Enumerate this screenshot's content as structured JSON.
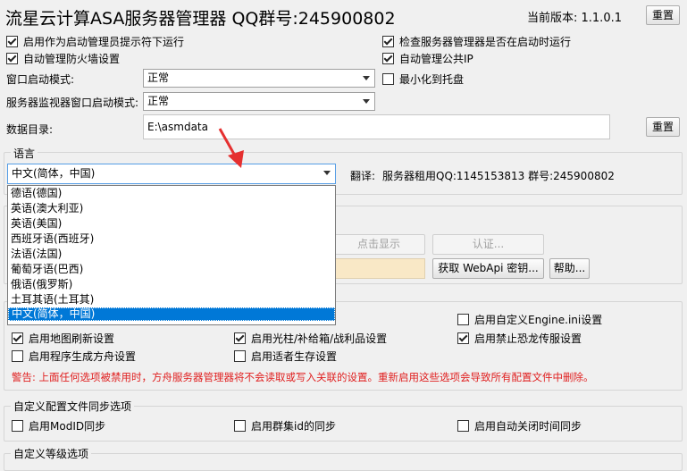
{
  "header": {
    "title": "流星云计算ASA服务器管理器 QQ群号:245900802",
    "version_label": "当前版本:  1.1.0.1",
    "reset_label": "重置"
  },
  "options": {
    "run_as_admin": {
      "label": "启用作为启动管理员提示符下运行",
      "checked": true
    },
    "check_startup": {
      "label": "检查服务器管理器是否在启动时运行",
      "checked": true
    },
    "auto_firewall": {
      "label": "自动管理防火墙设置",
      "checked": true
    },
    "auto_public_ip": {
      "label": "自动管理公共IP",
      "checked": true
    },
    "minimize_tray": {
      "label": "最小化到托盘",
      "checked": false
    }
  },
  "window_mode": {
    "label": "窗口启动模式:",
    "value": "正常"
  },
  "monitor_mode": {
    "label": "服务器监视器窗口启动模式:",
    "value": "正常"
  },
  "data_dir": {
    "label": "数据目录:",
    "value": "E:\\asmdata",
    "reset_label": "重置"
  },
  "language": {
    "group_title": "语言",
    "selected": "中文(简体，中国)",
    "translation_label": "翻译:",
    "translation_credit": "服务器租用QQ:1145153813 群号:245900802",
    "options": [
      "德语(德国)",
      "英语(澳大利亚)",
      "英语(美国)",
      "西班牙语(西班牙)",
      "法语(法国)",
      "葡萄牙语(巴西)",
      "俄语(俄罗斯)",
      "土耳其语(土耳其)",
      "中文(简体，中国)"
    ]
  },
  "webapi": {
    "show_label": "点击显示",
    "auth_label": "认证...",
    "get_key_label": "获取 WebApi 密钥...",
    "help_label": "帮助..."
  },
  "custom": {
    "engine_ini": {
      "label": "启用自定义Engine.ini设置",
      "checked": false
    },
    "map_refresh": {
      "label": "启用地图刷新设置",
      "checked": true
    },
    "beacon": {
      "label": "启用光柱/补给箱/战利品设置",
      "checked": true
    },
    "dino_spread": {
      "label": "启用禁止恐龙传服设置",
      "checked": true
    },
    "ark_gen": {
      "label": "启用程序生成方舟设置",
      "checked": false
    },
    "survivor": {
      "label": "启用适者生存设置",
      "checked": false
    },
    "warning": "警告: 上面任何选项被禁用时，方舟服务器管理器将不会读取或写入关联的设置。重新启用这些选项会导致所有配置文件中删除。"
  },
  "sync": {
    "group_title": "自定义配置文件同步选项",
    "mod_id": {
      "label": "启用ModID同步",
      "checked": false
    },
    "cluster_id": {
      "label": "启用群集id的同步",
      "checked": false
    },
    "auto_shutdown": {
      "label": "启用自动关闭时间同步",
      "checked": false
    }
  },
  "levels": {
    "group_title": "自定义等级选项"
  }
}
